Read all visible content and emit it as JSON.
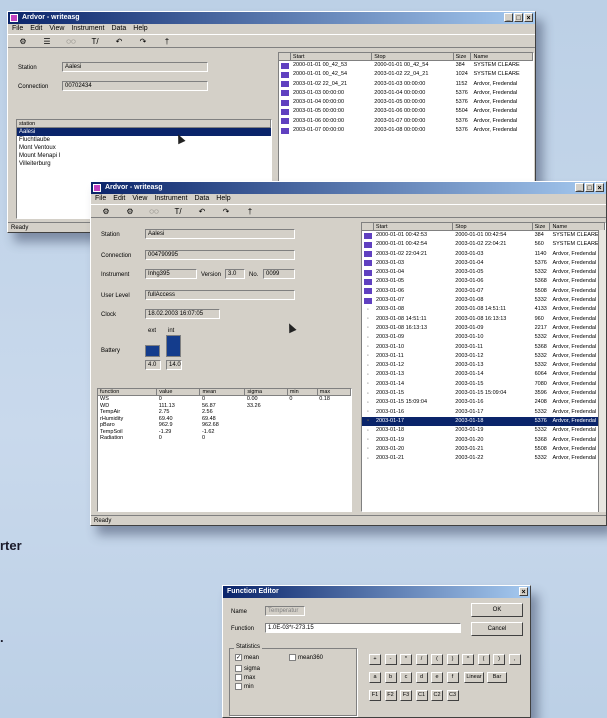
{
  "side_text": {
    "rter": "rter",
    "period": "."
  },
  "win1": {
    "title": "Ardvor - writeasg",
    "menu": [
      "File",
      "Edit",
      "View",
      "Instrument",
      "Data",
      "Help"
    ],
    "toolbar": [
      "⚙",
      "☰",
      "◌◌",
      "T/",
      "↶",
      "↷",
      "†"
    ],
    "station_label": "Station",
    "station_value": "Aalesi",
    "connection_label": "Connection",
    "connection_value": "00702434",
    "list_header": "station",
    "list": [
      "Aalesi",
      "Fluchtlaube",
      "Mont Ventoux",
      "Mount Menapi I",
      "Villeiterburg"
    ],
    "status": "Ready",
    "columns": [
      "Start",
      "Stop",
      "Size",
      "Name"
    ],
    "rows": [
      [
        "2000-01-01 00_42_53",
        "2000-01-01 00_42_54",
        "384",
        "SYSTEM CLEARE"
      ],
      [
        "2000-01-01 00_42_54",
        "2003-01-02 22_04_21",
        "1024",
        "SYSTEM CLEARE"
      ],
      [
        "2003-01-02 22_04_21",
        "2003-01-03 00:00:00",
        "1152",
        "Ardvor, Fredendal"
      ],
      [
        "2003-01-03 00:00:00",
        "2003-01-04 00:00:00",
        "5376",
        "Ardvor, Fredendal"
      ],
      [
        "2003-01-04 00:00:00",
        "2003-01-05 00:00:00",
        "5376",
        "Ardvor, Fredendal"
      ],
      [
        "2003-01-05 00:00:00",
        "2003-01-06 00:00:00",
        "5504",
        "Ardvor, Fredendal"
      ],
      [
        "2003-01-06 00:00:00",
        "2003-01-07 00:00:00",
        "5376",
        "Ardvor, Fredendal"
      ],
      [
        "2003-01-07 00:00:00",
        "2003-01-08 00:00:00",
        "5376",
        "Ardvor, Fredendal"
      ]
    ]
  },
  "win2": {
    "title": "Ardvor - writeasg",
    "menu": [
      "File",
      "Edit",
      "View",
      "Instrument",
      "Data",
      "Help"
    ],
    "toolbar": [
      "⚙",
      "⚙",
      "◌◌",
      "T/",
      "↶",
      "↷",
      "†"
    ],
    "station_label": "Station",
    "station_value": "Aalesi",
    "connection_label": "Connection",
    "connection_value": "004790995",
    "instrument_label": "Instrument",
    "instrument_value": "Inhg395",
    "version_label": "Version",
    "version_value": "3.0",
    "no_label": "No.",
    "no_value": "0099",
    "userlevel_label": "User Level",
    "userlevel_value": "fullAccess",
    "clock_label": "Clock",
    "clock_value": "18.02.2003 16:07:05",
    "battery_label": "Battery",
    "battery_top": [
      "ext",
      "int"
    ],
    "battery_bottom": [
      "4.0",
      "14.0"
    ],
    "table_columns": [
      "function",
      "value",
      "mean",
      "sigma",
      "min",
      "max"
    ],
    "table_rows": [
      [
        "WS",
        "0",
        "0",
        "0.00",
        "0",
        "0.18"
      ],
      [
        "WD",
        "111.13",
        "56.87",
        "33.26",
        "",
        ""
      ],
      [
        "TempAir",
        "2.75",
        "2.56",
        "",
        "",
        ""
      ],
      [
        "rHumidity",
        "69.40",
        "69.48",
        "",
        "",
        ""
      ],
      [
        "pBaro",
        "962.9",
        "962.68",
        "",
        "",
        ""
      ],
      [
        "TempSoil",
        "-1.29",
        "-1.62",
        "",
        "",
        ""
      ],
      [
        "Radiation",
        "0",
        "0",
        "",
        "",
        ""
      ]
    ],
    "status": "Ready",
    "columns": [
      "Start",
      "Stop",
      "Size",
      "Name"
    ],
    "rows": [
      [
        "2000-01-01 00:42:53",
        "2000-01-01 00:42:54",
        "384",
        "SYSTEM CLEARE"
      ],
      [
        "2000-01-01 00:42:54",
        "2003-01-02 22:04:21",
        "560",
        "SYSTEM CLEARE"
      ],
      [
        "2003-01-02 22:04:21",
        "2003-01-03",
        "1140",
        "Ardvor, Fredendal"
      ],
      [
        "2003-01-03",
        "2003-01-04",
        "5376",
        "Ardvor, Fredendal"
      ],
      [
        "2003-01-04",
        "2003-01-05",
        "5332",
        "Ardvor, Fredendal"
      ],
      [
        "2003-01-05",
        "2003-01-06",
        "5368",
        "Ardvor, Fredendal"
      ],
      [
        "2003-01-06",
        "2003-01-07",
        "5508",
        "Ardvor, Fredendal"
      ],
      [
        "2003-01-07",
        "2003-01-08",
        "5332",
        "Ardvor, Fredendal"
      ],
      [
        "2003-01-08",
        "2003-01-08 14:51:11",
        "4133",
        "Ardvor, Fredendal"
      ],
      [
        "2003-01-08 14:51:11",
        "2003-01-08 16:13:13",
        "960",
        "Ardvor, Fredendal"
      ],
      [
        "2003-01-08 16:13:13",
        "2003-01-09",
        "2217",
        "Ardvor, Fredendal"
      ],
      [
        "2003-01-09",
        "2003-01-10",
        "5332",
        "Ardvor, Fredendal"
      ],
      [
        "2003-01-10",
        "2003-01-11",
        "5368",
        "Ardvor, Fredendal"
      ],
      [
        "2003-01-11",
        "2003-01-12",
        "5332",
        "Ardvor, Fredendal"
      ],
      [
        "2003-01-12",
        "2003-01-13",
        "5332",
        "Ardvor, Fredendal"
      ],
      [
        "2003-01-13",
        "2003-01-14",
        "6064",
        "Ardvor, Fredendal"
      ],
      [
        "2003-01-14",
        "2003-01-15",
        "7080",
        "Ardvor, Fredendal"
      ],
      [
        "2003-01-15",
        "2003-01-15 15:09:04",
        "3596",
        "Ardvor, Fredendal"
      ],
      [
        "2003-01-15 15:09:04",
        "2003-01-16",
        "2408",
        "Ardvor, Fredendal"
      ],
      [
        "2003-01-16",
        "2003-01-17",
        "5332",
        "Ardvor, Fredendal"
      ],
      [
        "2003-01-17",
        "2003-01-18",
        "5376",
        "Ardvor, Fredendal"
      ],
      [
        "2003-01-18",
        "2003-01-19",
        "5332",
        "Ardvor, Fredendal"
      ],
      [
        "2003-01-19",
        "2003-01-20",
        "5368",
        "Ardvor, Fredendal"
      ],
      [
        "2003-01-20",
        "2003-01-21",
        "5508",
        "Ardvor, Fredendal"
      ],
      [
        "2003-01-21",
        "2003-01-22",
        "5332",
        "Ardvor, Fredendal"
      ]
    ],
    "selected_row": 20
  },
  "win3": {
    "title": "Function Editor",
    "name_label": "Name",
    "name_value": "Temperatur",
    "function_label": "Function",
    "function_value": "1.0E-03*r-273.15",
    "ok_label": "OK",
    "cancel_label": "Cancel",
    "statistics_label": "Statistics",
    "checks": [
      {
        "label": "mean",
        "checked": true
      },
      {
        "label": "mean360",
        "checked": false
      },
      {
        "label": "sigma",
        "checked": false
      },
      {
        "label": "max",
        "checked": false
      },
      {
        "label": "min",
        "checked": false
      }
    ],
    "keys_row1": [
      "+",
      "-",
      "*",
      "/",
      "(",
      ")",
      "^",
      "(",
      ")",
      ","
    ],
    "keys_row2": [
      "a",
      "b",
      "c",
      "d",
      "e",
      "f"
    ],
    "keys_row2_wide": [
      "Linear",
      "Bar"
    ],
    "keys_row3": [
      "F1",
      "F2",
      "F3",
      "C1",
      "C2",
      "C3"
    ]
  },
  "colors": {
    "selection": "#0a246a",
    "titlebar": "#0a246a",
    "face": "#d4d0c8",
    "battery": "#143c8c"
  }
}
